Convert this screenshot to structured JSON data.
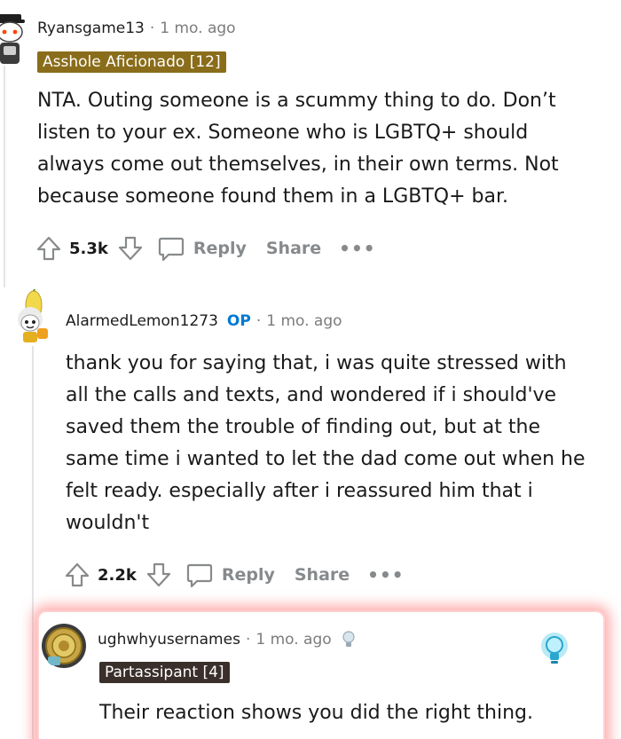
{
  "comments": [
    {
      "username": "Ryansgame13",
      "time": "1 mo. ago",
      "flair": "Asshole Aficionado [12]",
      "flair_color": "#8a6d1a",
      "body": "NTA. Outing someone is a scummy thing to do. Don’t listen to your ex. Someone who is LGBTQ+ should always come out themselves, in their own terms. Not because someone found them in a LGBTQ+ bar.",
      "votes": "5.3k",
      "reply": "Reply",
      "share": "Share",
      "more": "•••"
    },
    {
      "username": "AlarmedLemon1273",
      "op_badge": "OP",
      "time": "1 mo. ago",
      "body": "thank you for saying that, i was quite stressed with all the calls and texts, and wondered if i should've saved them the trouble of finding out, but at the same time i wanted to let the dad come out when he felt ready. especially after i reassured him that i wouldn't",
      "votes": "2.2k",
      "reply": "Reply",
      "share": "Share",
      "more": "•••"
    },
    {
      "username": "ughwhyusernames",
      "time": "1 mo. ago",
      "flair": "Partassipant [4]",
      "flair_color": "#3a2f2a",
      "body": "Their reaction shows you did the right thing."
    }
  ],
  "colors": {
    "op": "#0079d3",
    "meta_gray": "#7c7c7c",
    "action_gray": "#878a8c",
    "highlight_glow": "#ff6e6e"
  },
  "icons": [
    "snoo-avatar-icon",
    "lemon-avatar-icon",
    "coin-avatar-icon",
    "upvote-icon",
    "downvote-icon",
    "comment-icon",
    "lightbulb-icon",
    "lightbulb-award-icon"
  ]
}
